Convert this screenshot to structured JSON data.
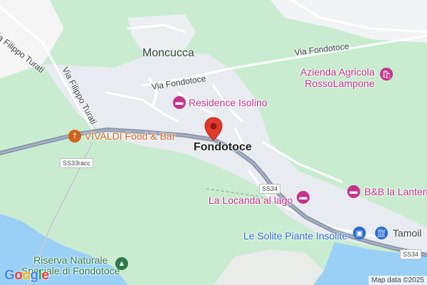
{
  "colors": {
    "park": "#c9ecd0",
    "land": "#ffffff",
    "urban": "#e8ebef",
    "water": "#9ad0f5",
    "highway": "#8b95ac",
    "road": "#ffffff",
    "poi_pink": "#c5338b",
    "poi_orange": "#d0621f",
    "poi_blue": "#2a6bd0",
    "poi_green": "#2f7a47",
    "pin_red": "#e2382d"
  },
  "places": {
    "moncucca": "Moncucca",
    "fondotoce": "Fondotoce"
  },
  "streets": {
    "via_filippo_turati_1": "Via Filippo Turati",
    "via_filippo_turati_2": "Via Filippo Turati",
    "via_fondotoce_1": "Via Fondotoce",
    "via_fondotoce_2": "Via Fondotoce"
  },
  "road_shields": {
    "ss33racc": "SS33racc",
    "ss34_a": "SS34",
    "ss34_b": "SS34"
  },
  "pois": {
    "azienda_line1": "Azienda Agricola",
    "azienda_line2": "RossoLampone",
    "residence": "Residence Isolino",
    "vivaldi": "VIVALDI Food & Bar",
    "locanda": "La Locanda al lago",
    "bb": "B&B la Lantern",
    "solite": "Le Solite Piante Insolite",
    "tamoil": "Tamoil",
    "riserva_line1": "Riserva Naturale",
    "riserva_line2": "Speciale di Fondotoce"
  },
  "icons": {
    "hotel": "bed-icon",
    "restaurant": "fork-knife-icon",
    "shop": "shopping-bag-icon",
    "fuel": "fuel-pump-icon",
    "park": "tree-icon",
    "location": "location-pin-icon"
  },
  "footer": {
    "logo_letters": [
      "G",
      "o",
      "o",
      "g",
      "l",
      "e"
    ],
    "attribution": "Map data ©2025"
  }
}
